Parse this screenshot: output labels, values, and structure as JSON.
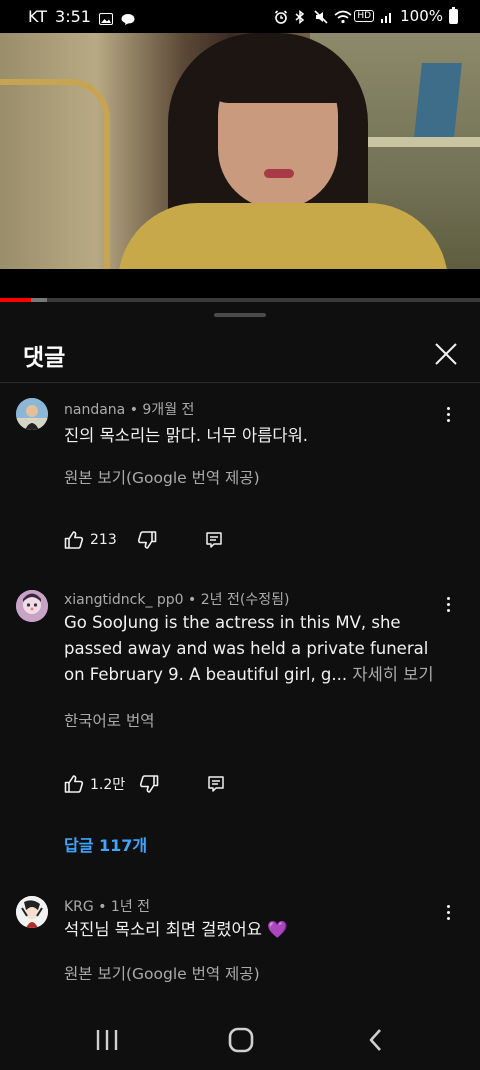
{
  "status_bar": {
    "carrier": "KT",
    "time": "3:51",
    "battery": "100%",
    "hd": "HD"
  },
  "video": {
    "progress": 0.065,
    "buffered": 0.097
  },
  "panel": {
    "title": "댓글"
  },
  "comments": [
    {
      "meta": "nandana • 9개월 전",
      "text": "진의 목소리는 맑다. 너무 아름다워.",
      "translate": "원본 보기(Google 번역 제공)",
      "likes": "213"
    },
    {
      "meta": "xiangtidnck_ pp0 • 2년 전(수정됨)",
      "text": "Go SooJung is the actress in this MV, she passed away and was held a private funeral on February 9.  A beautiful girl, g... ",
      "more": "자세히 보기",
      "translate": "한국어로 번역",
      "likes": "1.2만",
      "replies": "답글 117개"
    },
    {
      "meta": "KRG • 1년 전",
      "text": "석진님 목소리 최면 걸렸어요 💜",
      "translate": "원본 보기(Google 번역 제공)"
    }
  ],
  "colors": {
    "accent": "#3ea6ff",
    "progress": "#ff0000",
    "background": "#0f0f0f"
  }
}
